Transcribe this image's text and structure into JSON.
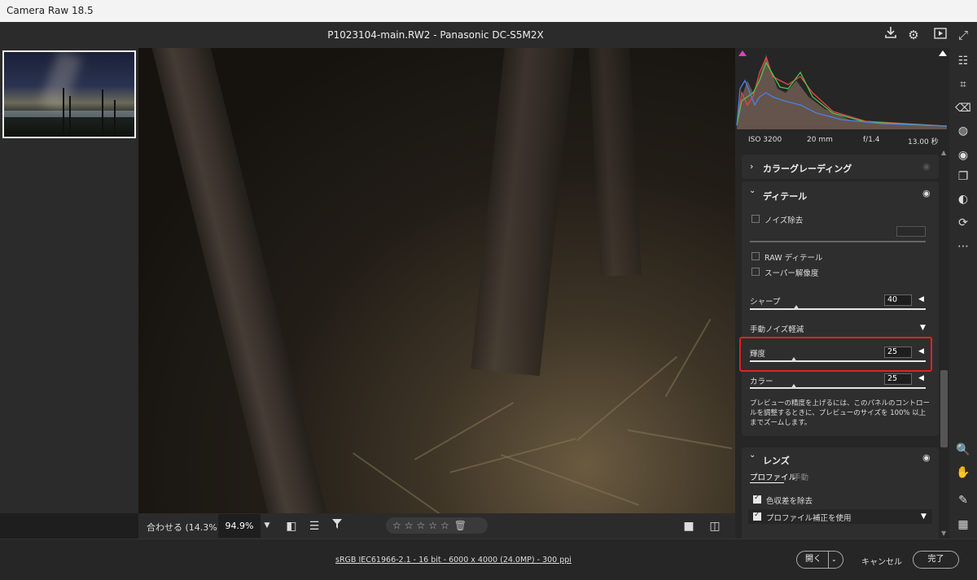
{
  "window": {
    "title": "Camera Raw 18.5"
  },
  "header": {
    "file_name": "P1023104-main.RW2  -  Panasonic DC-S5M2X",
    "icons": [
      "save-icon",
      "gear-icon",
      "slideshow-icon",
      "fullscreen-icon"
    ]
  },
  "histogram": {
    "iso": "ISO 3200",
    "focal": "20 mm",
    "aperture": "f/1.4",
    "shutter": "13.00 秒"
  },
  "viewer_bar": {
    "fit_label": "合わせる (14.3%)",
    "zoom_value": "94.9%",
    "rating_stars": "☆☆☆☆☆"
  },
  "panels": {
    "color_grading": {
      "title": "カラーグレーディング"
    },
    "detail": {
      "title": "ディテール",
      "noise_reduction": "ノイズ除去",
      "raw_detail": "RAW ディテール",
      "super_resolution": "スーパー解像度",
      "sharpen": {
        "label": "シャープ",
        "value": "40"
      },
      "manual_noise": "手動ノイズ軽減",
      "luminance": {
        "label": "輝度",
        "value": "25"
      },
      "color": {
        "label": "カラー",
        "value": "25"
      },
      "hint": "プレビューの精度を上げるには、このパネルのコントロールを調整するときに、プレビューのサイズを 100% 以上までズームします。"
    },
    "lens": {
      "title": "レンズ",
      "tab_profile": "プロファイル",
      "tab_manual": "手動",
      "remove_ca": "色収差を除去",
      "use_profile": "プロファイル補正を使用"
    }
  },
  "footer": {
    "info": "sRGB IEC61966-2.1 - 16 bit - 6000 x 4000 (24.0MP) - 300 ppi",
    "open_label": "開く",
    "cancel_label": "キャンセル",
    "done_label": "完了"
  }
}
